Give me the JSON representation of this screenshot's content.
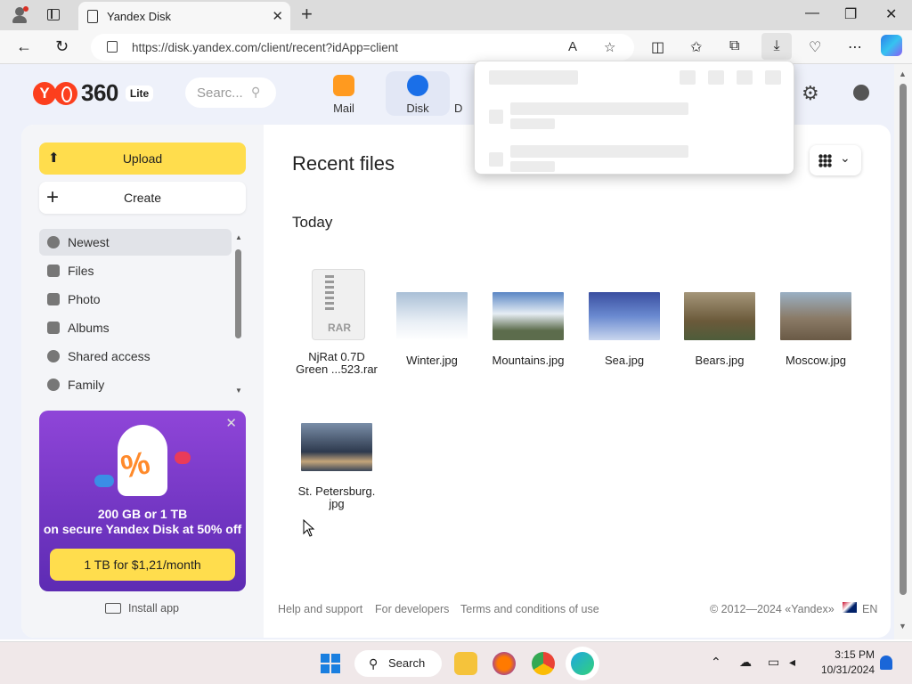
{
  "browser": {
    "tab_title": "Yandex Disk",
    "url": "https://disk.yandex.com/client/recent?idApp=client"
  },
  "header": {
    "logo_text": "360",
    "lite_badge": "Lite",
    "search_placeholder": "Searc...",
    "services": [
      {
        "label": "Mail",
        "icon": "mail-icon",
        "color": "#ff9a1f"
      },
      {
        "label": "Disk",
        "icon": "disk-icon",
        "color": "#1a6fe8"
      },
      {
        "label": "D",
        "icon": "docs-icon",
        "color": "#555555"
      }
    ]
  },
  "sidebar": {
    "upload_label": "Upload",
    "create_label": "Create",
    "nav": [
      {
        "label": "Newest",
        "icon": "clock-icon",
        "active": true
      },
      {
        "label": "Files",
        "icon": "file-icon"
      },
      {
        "label": "Photo",
        "icon": "image-icon"
      },
      {
        "label": "Albums",
        "icon": "album-icon"
      },
      {
        "label": "Shared access",
        "icon": "people-icon"
      },
      {
        "label": "Family",
        "icon": "heart-icon"
      }
    ],
    "promo": {
      "line1": "200 GB or 1 TB",
      "line2": "on secure Yandex Disk at 50% off",
      "cta": "1 TB for $1,21/month"
    },
    "install_app": "Install app"
  },
  "main": {
    "title": "Recent files",
    "section": "Today",
    "files": [
      {
        "name_line1": "NjRat 0.7D",
        "name_line2": "Green ...523.rar",
        "type": "rar",
        "badge": "RAR"
      },
      {
        "name_line1": "Winter.jpg",
        "type": "image",
        "color": "#c9d6e4"
      },
      {
        "name_line1": "Mountains.jpg",
        "type": "image",
        "color": "#5a86c4"
      },
      {
        "name_line1": "Sea.jpg",
        "type": "image",
        "color": "#5560b0"
      },
      {
        "name_line1": "Bears.jpg",
        "type": "image",
        "color": "#7a6a45"
      },
      {
        "name_line1": "Moscow.jpg",
        "type": "image",
        "color": "#8a7a66"
      },
      {
        "name_line1": "St. Petersburg.",
        "name_line2": "jpg",
        "type": "image",
        "color": "#4a5e78"
      }
    ]
  },
  "footer": {
    "links": [
      "Help and support",
      "For developers",
      "Terms and conditions of use"
    ],
    "copyright": "© 2012—2024 «Yandex»",
    "language": "EN"
  },
  "taskbar": {
    "search_label": "Search",
    "time": "3:15 PM",
    "date": "10/31/2024"
  }
}
